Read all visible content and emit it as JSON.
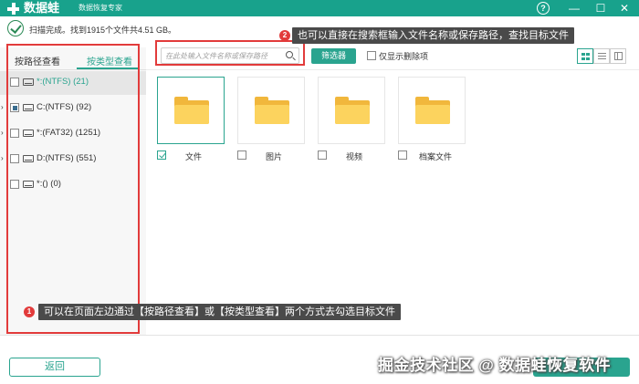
{
  "titlebar": {
    "app_name": "数据蛙",
    "app_subtitle": "数据恢复专家",
    "help_glyph": "?",
    "min_glyph": "—",
    "max_glyph": "☐",
    "close_glyph": "✕"
  },
  "status": {
    "text": "扫描完成。找到1915个文件共4.51 GB。"
  },
  "left_panel": {
    "tabs": [
      {
        "label": "按路径查看",
        "active": false
      },
      {
        "label": "按类型查看",
        "active": true
      }
    ],
    "tree": [
      {
        "label": "*:(NTFS) (21)",
        "check": "none",
        "expandable": false,
        "selected": true
      },
      {
        "label": "C:(NTFS) (92)",
        "check": "partial",
        "expandable": true,
        "selected": false
      },
      {
        "label": "*:(FAT32) (1251)",
        "check": "none",
        "expandable": true,
        "selected": false
      },
      {
        "label": "D:(NTFS) (551)",
        "check": "none",
        "expandable": true,
        "selected": false
      },
      {
        "label": "*:() (0)",
        "check": "none",
        "expandable": false,
        "selected": false
      }
    ],
    "expand_glyph": "›"
  },
  "toolbar": {
    "search_placeholder": "在此处输入文件名称或保存路径",
    "filter_label": "筛选器",
    "deleted_only_label": "仅显示删除项"
  },
  "annotations": {
    "callout_1": {
      "number": "1",
      "text": "可以在页面左边通过【按路径查看】或【按类型查看】两个方式去勾选目标文件"
    },
    "callout_2": {
      "number": "2",
      "text": "也可以直接在搜索框输入文件名称或保存路径，查找目标文件"
    }
  },
  "file_types": [
    {
      "label": "文件",
      "checked": true,
      "selected": true
    },
    {
      "label": "图片",
      "checked": false,
      "selected": false
    },
    {
      "label": "视频",
      "checked": false,
      "selected": false
    },
    {
      "label": "档案文件",
      "checked": false,
      "selected": false
    }
  ],
  "bottom": {
    "back_label": "返回",
    "watermark": "掘金技术社区 @ 数据蛙恢复软件"
  },
  "colors": {
    "accent": "#2aa48f",
    "titlebar": "#18a28c",
    "annotation_red": "#e23b3b",
    "folder": "#fcd35e"
  }
}
